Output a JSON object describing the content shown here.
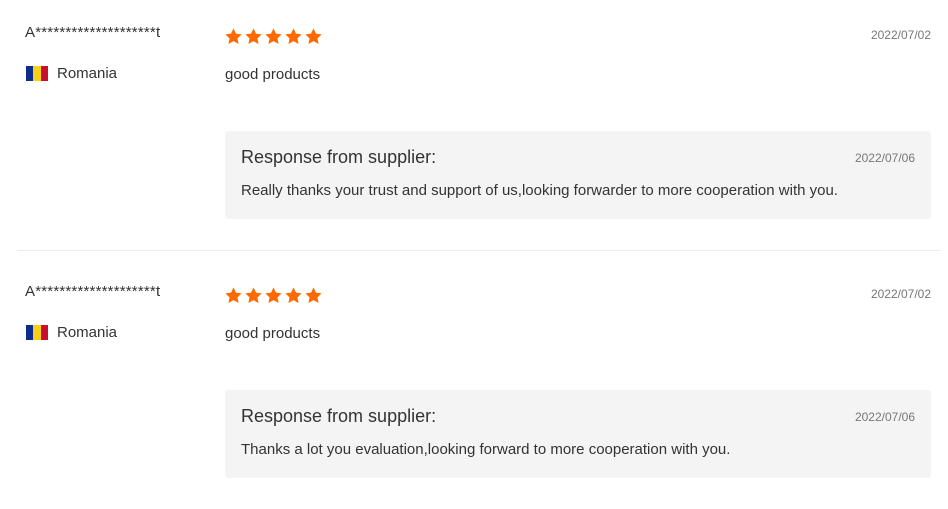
{
  "accent_color": "#ff6a00",
  "reviews": [
    {
      "buyer": "A********************t",
      "country": "Romania",
      "flag_icon": "romania-flag-icon",
      "rating": 5,
      "date": "2022/07/02",
      "text": "good products",
      "response": {
        "title": "Response from supplier:",
        "date": "2022/07/06",
        "text": "Really thanks your trust and support of us,looking forwarder to more cooperation with you."
      }
    },
    {
      "buyer": "A********************t",
      "country": "Romania",
      "flag_icon": "romania-flag-icon",
      "rating": 5,
      "date": "2022/07/02",
      "text": "good products",
      "response": {
        "title": "Response from supplier:",
        "date": "2022/07/06",
        "text": "Thanks a lot you evaluation,looking forward to more cooperation with you."
      }
    }
  ]
}
